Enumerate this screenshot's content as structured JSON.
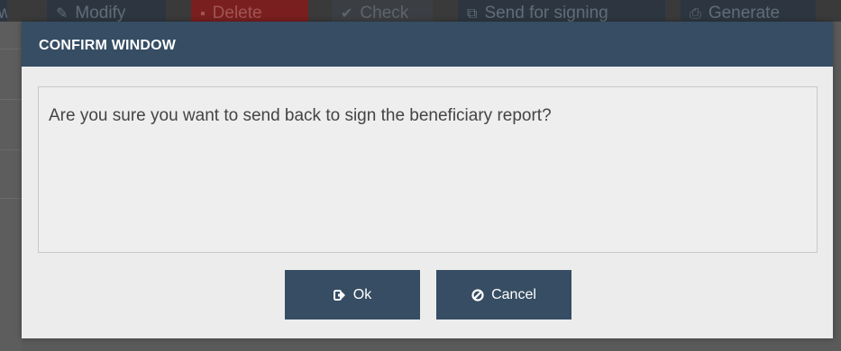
{
  "background": {
    "toolbar_buttons": [
      {
        "label": "Modify",
        "icon": "pencil-icon"
      },
      {
        "label": "Delete",
        "icon": "trash-icon"
      },
      {
        "label": "Check",
        "icon": "check-icon"
      },
      {
        "label": "Send for signing",
        "icon": "external-link-icon"
      },
      {
        "label": "Generate",
        "icon": "print-icon"
      }
    ]
  },
  "modal": {
    "title": "CONFIRM WINDOW",
    "message": "Are you sure you want to send back to sign the beneficiary report?",
    "buttons": {
      "ok_label": "Ok",
      "ok_icon": "sign-in-icon",
      "cancel_label": "Cancel",
      "cancel_icon": "ban-icon"
    }
  },
  "colors": {
    "header": "#364d63",
    "button": "#364d63",
    "body_bg": "#ececec",
    "text": "#444444"
  }
}
